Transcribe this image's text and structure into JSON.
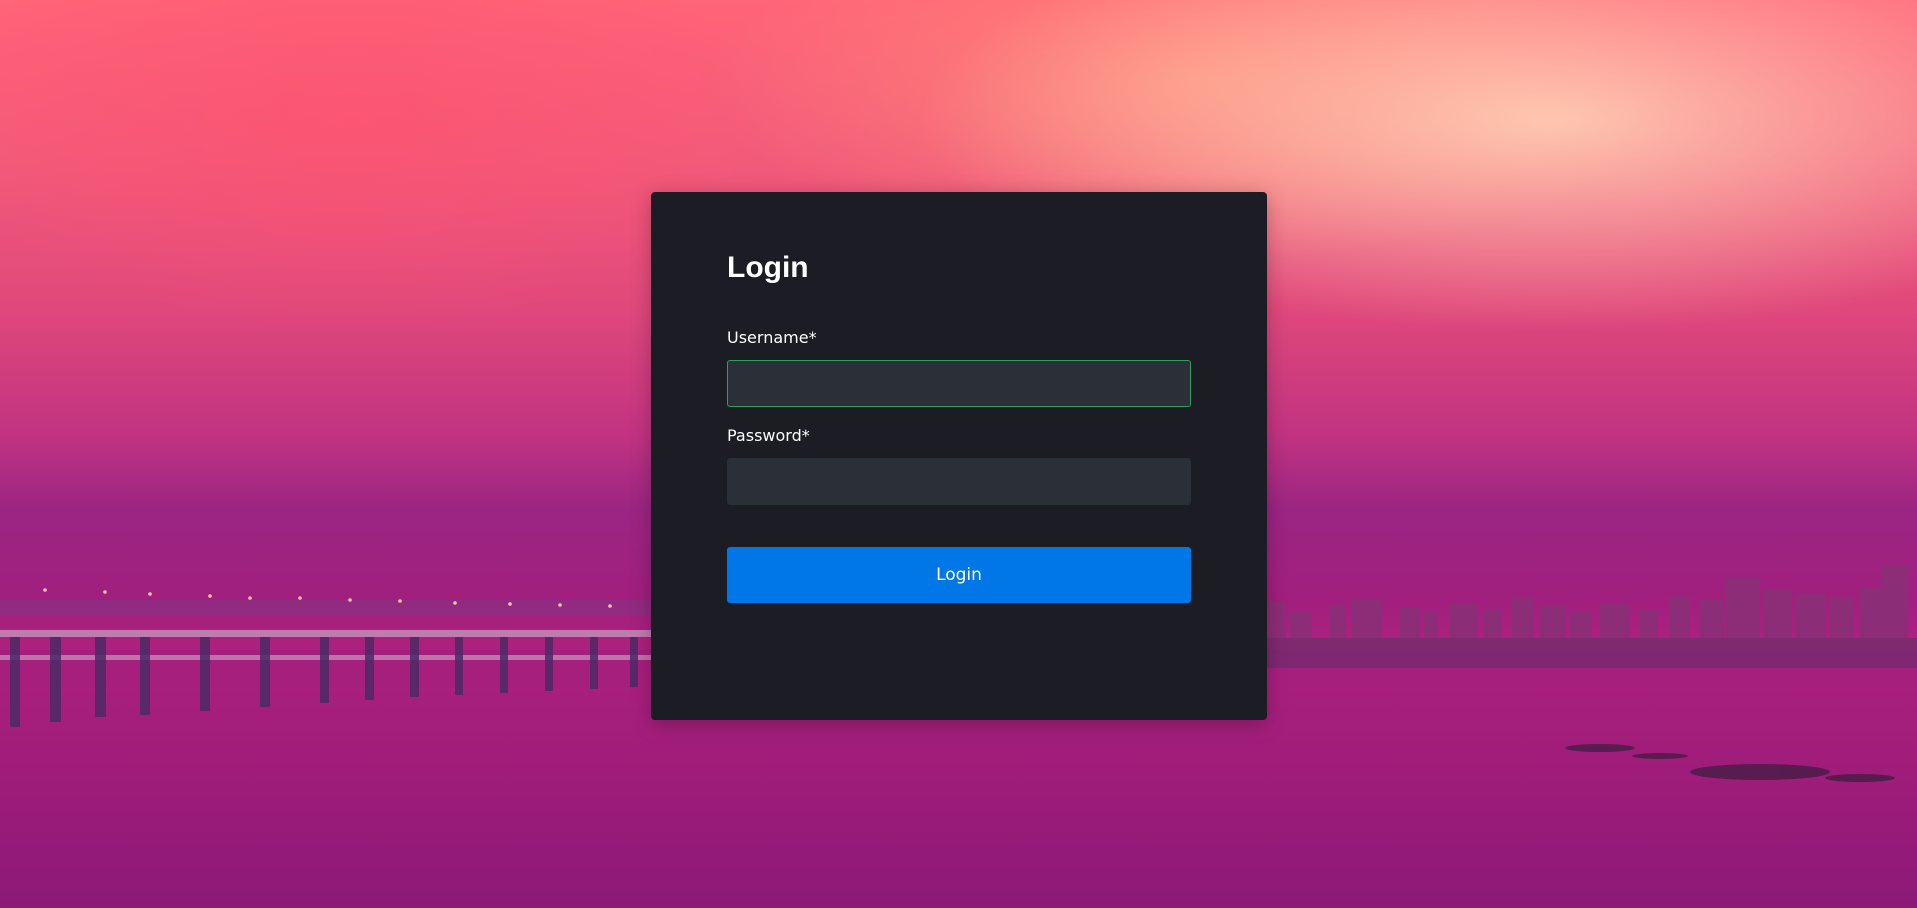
{
  "login": {
    "title": "Login",
    "username_label": "Username*",
    "username_value": "",
    "password_label": "Password*",
    "password_value": "",
    "submit_label": "Login"
  },
  "colors": {
    "card_background": "#1b1c24",
    "input_background": "#2a2f38",
    "focused_border": "#2f9e5a",
    "button": "#0077e6"
  }
}
